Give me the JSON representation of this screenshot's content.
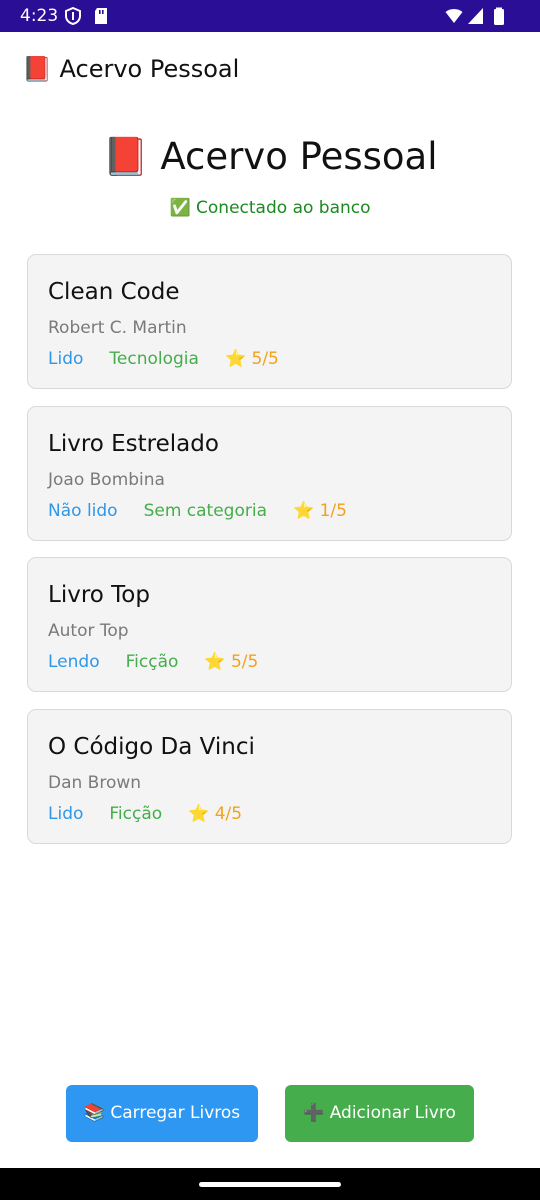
{
  "status_bar": {
    "time": "4:23"
  },
  "app_bar": {
    "title": "📕 Acervo Pessoal"
  },
  "header": {
    "title": "📕 Acervo Pessoal",
    "connection_status": "✅ Conectado ao banco"
  },
  "books": [
    {
      "title": "Clean Code",
      "author": "Robert C. Martin",
      "status": "Lido",
      "category": "Tecnologia",
      "rating": "⭐ 5/5"
    },
    {
      "title": "Livro Estrelado",
      "author": "Joao Bombina",
      "status": "Não lido",
      "category": "Sem categoria",
      "rating": "⭐ 1/5"
    },
    {
      "title": "Livro Top",
      "author": "Autor Top",
      "status": "Lendo",
      "category": "Ficção",
      "rating": "⭐ 5/5"
    },
    {
      "title": "O Código Da Vinci",
      "author": "Dan Brown",
      "status": "Lido",
      "category": "Ficção",
      "rating": "⭐ 4/5"
    }
  ],
  "actions": {
    "load_label": "📚 Carregar Livros",
    "add_label": "➕ Adicionar Livro"
  },
  "colors": {
    "status_bar": "#2a0f96",
    "status_text": "#2e97e8",
    "category_text": "#45ad4b",
    "rating_text": "#f2a21c",
    "connected_text": "#1b8a1f",
    "load_button": "#2e97f2",
    "add_button": "#45ad4b"
  },
  "icons": [
    "vpn-shield-icon",
    "sd-card-icon",
    "wifi-icon",
    "cell-signal-icon",
    "battery-icon"
  ]
}
